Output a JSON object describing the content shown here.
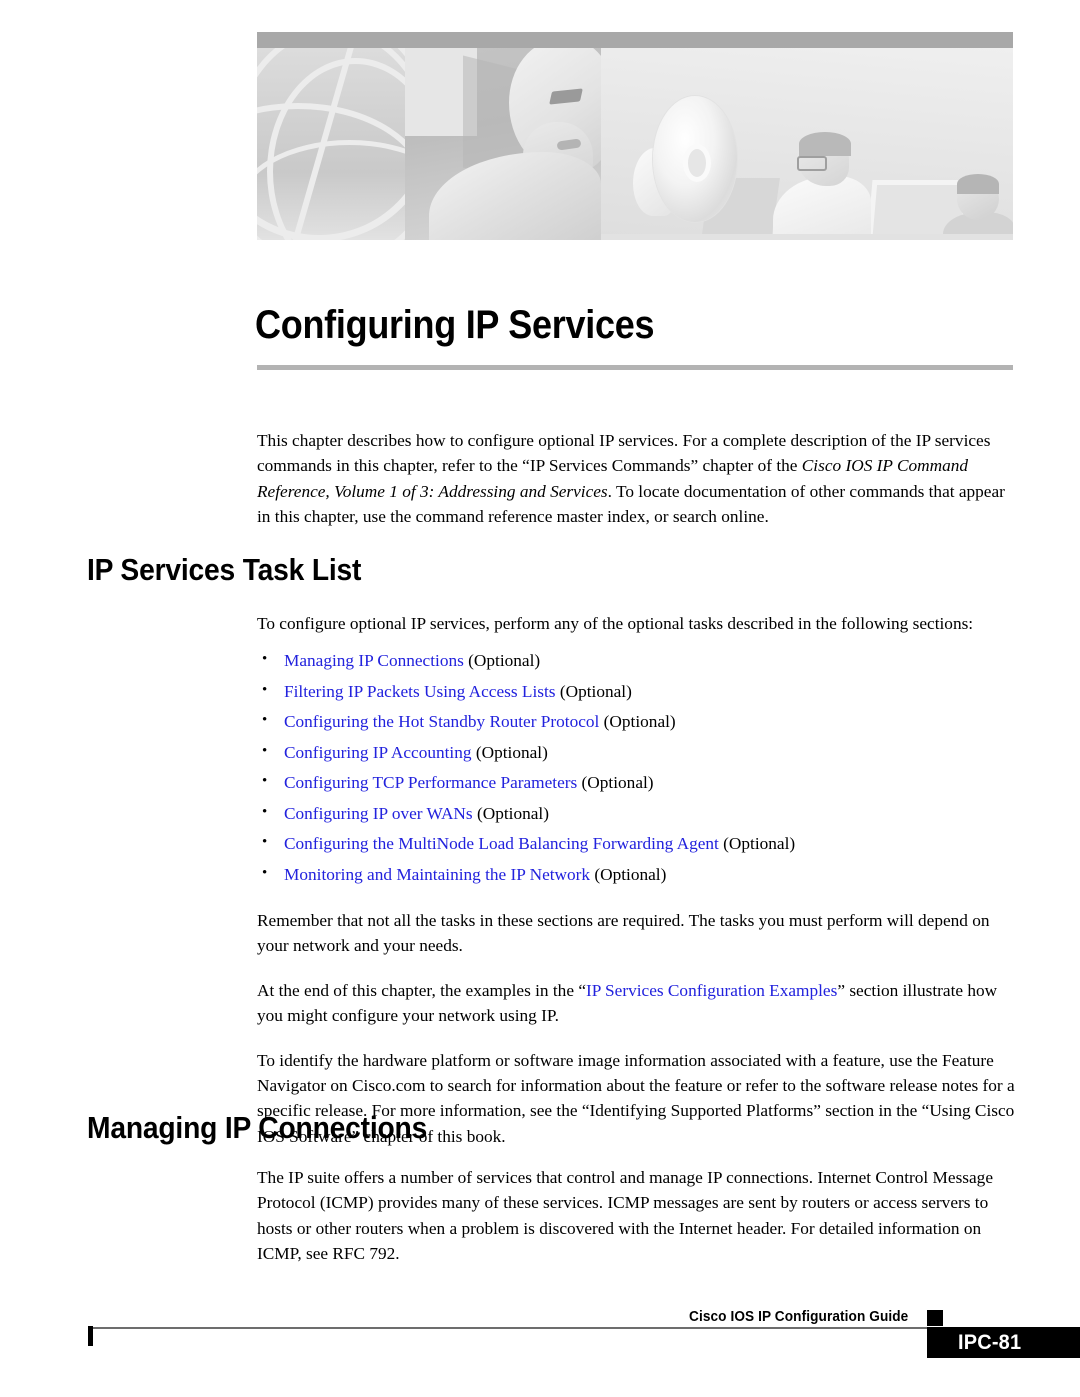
{
  "banner": {
    "alt": "grayscale illustration banner: globe wireframe, stylized face, compact disc and people at computer monitors"
  },
  "chapter": {
    "title": "Configuring IP Services",
    "intro": {
      "part1": "This chapter describes how to configure optional IP services. For a complete description of the IP services commands in this chapter, refer to the “IP Services Commands” chapter of the ",
      "italic": "Cisco IOS IP Command Reference, Volume 1 of 3: Addressing and Services",
      "part2": ". To locate documentation of other commands that appear in this chapter, use the command reference master index, or search online."
    }
  },
  "sections": [
    {
      "heading": "IP Services Task List",
      "lead": "To configure optional IP services, perform any of the optional tasks described in the following sections:",
      "tasks": [
        {
          "link": "Managing IP Connections",
          "suffix": " (Optional)"
        },
        {
          "link": "Filtering IP Packets Using Access Lists",
          "suffix": " (Optional)"
        },
        {
          "link": "Configuring the Hot Standby Router Protocol",
          "suffix": " (Optional)"
        },
        {
          "link": "Configuring IP Accounting",
          "suffix": " (Optional)"
        },
        {
          "link": "Configuring TCP Performance Parameters",
          "suffix": " (Optional)"
        },
        {
          "link": "Configuring IP over WANs",
          "suffix": " (Optional)"
        },
        {
          "link": "Configuring the MultiNode Load Balancing Forwarding Agent",
          "suffix": " (Optional)"
        },
        {
          "link": "Monitoring and Maintaining the IP Network",
          "suffix": " (Optional)"
        }
      ],
      "para_remember": "Remember that not all the tasks in these sections are required. The tasks you must perform will depend on your network and your needs.",
      "para_examples": {
        "before": "At the end of this chapter, the examples in the “",
        "link": "IP Services Configuration Examples",
        "after": "” section illustrate how you might configure your network using IP."
      },
      "para_feature": "To identify the hardware platform or software image information associated with a feature, use the Feature Navigator on Cisco.com to search for information about the feature or refer to the software release notes for a specific release. For more information, see the “Identifying Supported Platforms” section in the “Using Cisco IOS Software” chapter of this book."
    },
    {
      "heading": "Managing IP Connections",
      "para_icmp": "The IP suite offers a number of services that control and manage IP connections. Internet Control Message Protocol (ICMP) provides many of these services. ICMP messages are sent by routers or access servers to hosts or other routers when a problem is discovered with the Internet header. For detailed information on ICMP, see RFC 792."
    }
  ],
  "footer": {
    "guide_title": "Cisco IOS IP Configuration Guide",
    "page_number": "IPC-81"
  },
  "colors": {
    "link": "#2222dd",
    "rule_gray": "#b3b3b3",
    "banner_top": "#a8a8a8",
    "page_box": "#000000"
  }
}
